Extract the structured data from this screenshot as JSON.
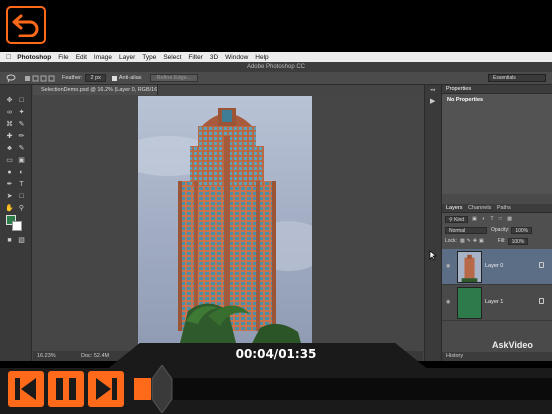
{
  "menubar": {
    "app_name": "Photoshop",
    "items": [
      "File",
      "Edit",
      "Image",
      "Layer",
      "Type",
      "Select",
      "Filter",
      "3D",
      "Window",
      "Help"
    ]
  },
  "window_title": "Adobe Photoshop CC",
  "options_bar": {
    "feather_label": "Feather:",
    "feather_value": "2 px",
    "anti_alias_label": "Anti-alias",
    "refine_edge_label": "Refine Edge...",
    "workspace_label": "Essentials"
  },
  "document_tab": "SelectionDemo.psd @ 16.2% (Layer 0, RGB/16) *",
  "status": {
    "zoom": "16.23%",
    "doc": "Doc: 52.4M"
  },
  "properties_panel": {
    "title": "Properties",
    "body": "No Properties"
  },
  "layers_panel": {
    "tabs": [
      "Layers",
      "Channels",
      "Paths"
    ],
    "kind_label": "Kind",
    "blend_mode": "Normal",
    "opacity_label": "Opacity:",
    "opacity_value": "100%",
    "lock_label": "Lock:",
    "fill_label": "Fill:",
    "fill_value": "100%",
    "layers": [
      {
        "name": "Layer 0",
        "selected": true
      },
      {
        "name": "Layer 1",
        "selected": false
      }
    ]
  },
  "history_tab": "History",
  "watermark": "AskVideo",
  "player": {
    "timecode": "00:04/01:35",
    "progress": 0.04,
    "accent": "#ff6a1a"
  },
  "icons": {
    "back": "back-arrow-icon",
    "rewind": "skip-back-icon",
    "pause": "pause-icon",
    "forward": "skip-forward-icon"
  }
}
